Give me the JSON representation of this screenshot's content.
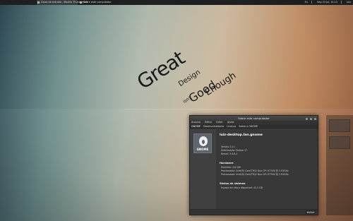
{
  "top_panel": {
    "tasks": [
      {
        "label": "Caixa de entrada - Mozilla Thunderbird"
      },
      {
        "label": "Sobre este computador"
      }
    ],
    "status": [
      "En",
      "Seg 23 Jul, 14:13",
      "luiz"
    ]
  },
  "wallpaper": {
    "great": "Great",
    "design": "Design",
    "isnt": "isn't",
    "good": "Good",
    "enough": "Enough"
  },
  "window": {
    "title": "Sobre este computador",
    "menu": [
      "Arquivo",
      "Editar",
      "Exibir",
      "Ajuda"
    ],
    "toolbar": [
      "GNOME",
      "Desenvolvedores",
      "Licença"
    ],
    "toolbar_title": "Sobre o GNOME",
    "logo_text": "GNOME",
    "hostname": "luiz-desktop.lan.gnome",
    "system_lines": [
      "Versão 3.4.1",
      "Distribuição: Fedora 17",
      "Kernel: 3.4.6-2"
    ],
    "hardware_heading": "Hardware",
    "hardware_lines": [
      "Memória: 3,8 GiB",
      "Processador: Intel(R) Core(TM)2 Duo CPU E7500 @ 2.93GHz",
      "Processador: Intel(R) Core(TM)2 Duo CPU E7500 @ 2.93GHz"
    ],
    "status_heading": "Status do sistema",
    "status_lines": [
      "Espaço em disco disponível: 41,2 GB"
    ],
    "close_label": "Fechar"
  }
}
